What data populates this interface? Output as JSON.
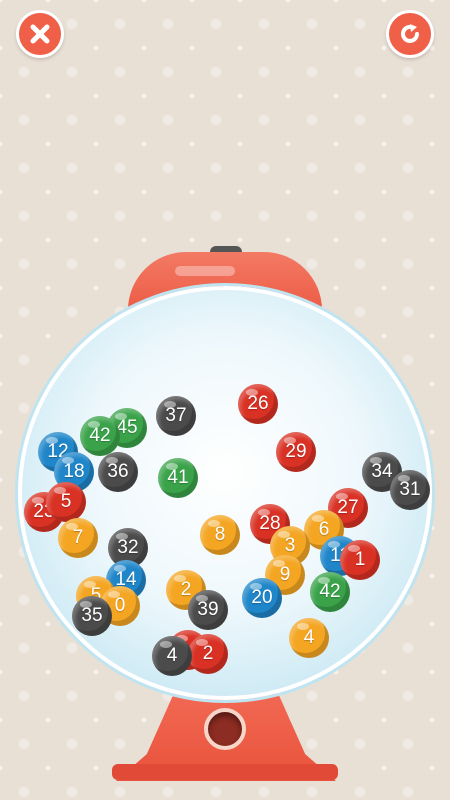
{
  "buttons": {
    "close_icon": "close-icon",
    "restart_icon": "restart-icon",
    "accent": "#f06048"
  },
  "balls": [
    {
      "label": "26",
      "color": "red"
    },
    {
      "label": "37",
      "color": "gray"
    },
    {
      "label": "45",
      "color": "green"
    },
    {
      "label": "42",
      "color": "green"
    },
    {
      "label": "12",
      "color": "blue"
    },
    {
      "label": "18",
      "color": "blue"
    },
    {
      "label": "36",
      "color": "gray"
    },
    {
      "label": "41",
      "color": "green"
    },
    {
      "label": "29",
      "color": "red"
    },
    {
      "label": "34",
      "color": "gray"
    },
    {
      "label": "31",
      "color": "gray"
    },
    {
      "label": "23",
      "color": "red"
    },
    {
      "label": "5",
      "color": "red"
    },
    {
      "label": "7",
      "color": "orange"
    },
    {
      "label": "8",
      "color": "orange"
    },
    {
      "label": "28",
      "color": "red"
    },
    {
      "label": "27",
      "color": "red"
    },
    {
      "label": "6",
      "color": "orange"
    },
    {
      "label": "3",
      "color": "orange"
    },
    {
      "label": "11",
      "color": "blue"
    },
    {
      "label": "1",
      "color": "red"
    },
    {
      "label": "32",
      "color": "gray"
    },
    {
      "label": "14",
      "color": "blue"
    },
    {
      "label": "9",
      "color": "orange"
    },
    {
      "label": "2",
      "color": "orange"
    },
    {
      "label": "39",
      "color": "gray"
    },
    {
      "label": "20",
      "color": "blue"
    },
    {
      "label": "42",
      "color": "green"
    },
    {
      "label": "5",
      "color": "orange"
    },
    {
      "label": "0",
      "color": "orange"
    },
    {
      "label": "35",
      "color": "gray"
    },
    {
      "label": "4",
      "color": "orange"
    },
    {
      "label": "24",
      "color": "red"
    },
    {
      "label": "2",
      "color": "red"
    },
    {
      "label": "4",
      "color": "gray"
    }
  ]
}
